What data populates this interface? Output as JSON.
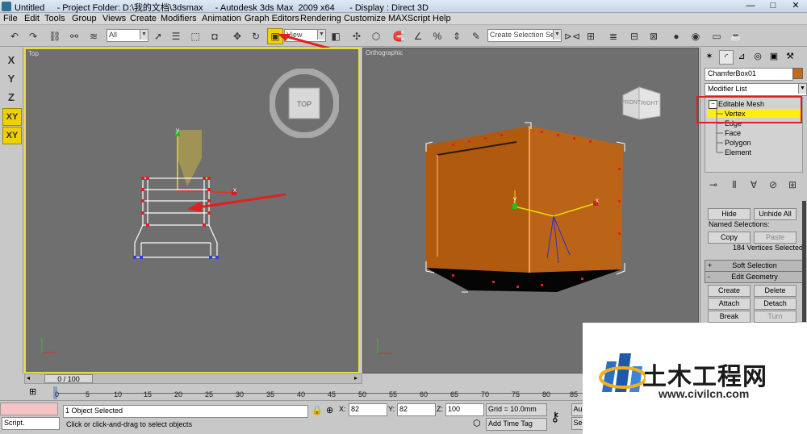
{
  "window": {
    "title": "Untitled     - Project Folder: D:\\我的文档\\3dsmax     - Autodesk 3ds Max  2009 x64      - Display : Direct 3D",
    "minimize": "—",
    "maximize": "□",
    "close": "✕"
  },
  "menu": [
    "File",
    "Edit",
    "Tools",
    "Group",
    "Views",
    "Create",
    "Modifiers",
    "Animation",
    "Graph Editors",
    "Rendering",
    "Customize",
    "MAXScript",
    "Help"
  ],
  "toolbar": {
    "selection_filter": "All",
    "ref_coord": "View",
    "named_selection_placeholder": "Create Selection Set",
    "highlight_color": "#f2d400"
  },
  "axes": [
    "X",
    "Y",
    "Z",
    "XY",
    "XY"
  ],
  "viewports": {
    "top_label": "Top",
    "ortho_label": "Orthographic",
    "viewcube_top": "TOP",
    "viewcube_front": "FRONT",
    "viewcube_right": "RIGHT",
    "gizmo_y": "y",
    "gizmo_x": "x",
    "active_border_color": "#e8dc40",
    "object_color": "#b05a10"
  },
  "command_panel": {
    "object_name": "ChamferBox01",
    "object_color": "#c06a20",
    "modifier_list": "Modifier List",
    "stack": {
      "root": "Editable Mesh",
      "items": [
        "Vertex",
        "Edge",
        "Face",
        "Polygon",
        "Element"
      ],
      "selected": "Vertex"
    },
    "selection": {
      "hide": "Hide",
      "unhide_all": "Unhide All",
      "named_selections": "Named Selections:",
      "copy": "Copy",
      "paste": "Paste",
      "status": "184 Vertices Selected"
    },
    "rollouts": {
      "soft_selection": "Soft Selection",
      "edit_geometry": "Edit Geometry",
      "soft_sign": "+",
      "edit_sign": "-"
    },
    "edit_geometry_buttons": [
      "Create",
      "Delete",
      "Attach",
      "Detach",
      "Break",
      "Turn"
    ]
  },
  "timeline": {
    "slider": "0 / 100",
    "ticks": [
      "0",
      "5",
      "10",
      "15",
      "20",
      "25",
      "30",
      "35",
      "40",
      "45",
      "50",
      "55",
      "60",
      "65",
      "70",
      "75",
      "80",
      "85"
    ]
  },
  "status": {
    "selected": "1 Object Selected",
    "prompt": "Click or click-and-drag to select objects",
    "script_label": "Script.",
    "x_label": "X:",
    "x_value": "82",
    "y_label": "Y:",
    "y_value": "82",
    "z_label": "Z:",
    "z_value": "100",
    "grid": "Grid = 10.0mm",
    "add_time_tag": "Add Time Tag",
    "auto_key": "Au",
    "set_key": "Se"
  },
  "watermark": {
    "cn": "土木工程网",
    "url": "www.civilcn.com"
  }
}
